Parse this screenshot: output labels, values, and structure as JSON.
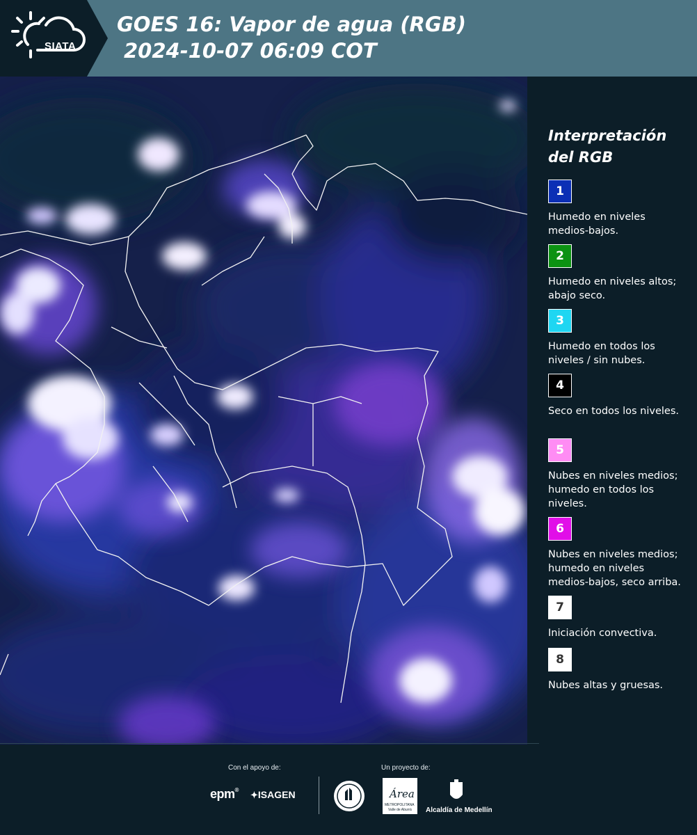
{
  "header": {
    "logo_text": "SIATA",
    "title_line1": "GOES 16: Vapor de agua (RGB)",
    "title_line2": "2024-10-07 06:09 COT",
    "band_color": "#4d7584",
    "dark_color": "#0c1e28"
  },
  "legend": {
    "title_line1": "Interpretación",
    "title_line2": "del RGB",
    "items": [
      {
        "number": "1",
        "color": "#0b2fb5",
        "text_color": "#ffffff",
        "label": "Humedo en niveles medios-bajos."
      },
      {
        "number": "2",
        "color": "#0c9212",
        "text_color": "#ffffff",
        "label": "Humedo en niveles altos; abajo seco."
      },
      {
        "number": "3",
        "color": "#1fd6f2",
        "text_color": "#ffffff",
        "label": "Humedo en todos los niveles / sin nubes."
      },
      {
        "number": "4",
        "color": "#000000",
        "text_color": "#ffffff",
        "label": "Seco en todos los niveles."
      },
      {
        "number": "5",
        "color": "#ff8cf4",
        "text_color": "#ffffff",
        "label": "Nubes en niveles medios; humedo en todos los niveles."
      },
      {
        "number": "6",
        "color": "#e10ee8",
        "text_color": "#ffffff",
        "label": "Nubes en niveles medios; humedo en niveles medios-bajos, seco arriba."
      },
      {
        "number": "7",
        "color": "#ffffff",
        "text_color": "#333333",
        "label": "Iniciación convectiva."
      },
      {
        "number": "8",
        "color": "#ffffff",
        "text_color": "#333333",
        "label": "Nubes altas y gruesas."
      }
    ]
  },
  "footer": {
    "support_label": "Con el apoyo de:",
    "project_label": "Un proyecto de:",
    "sponsor1": "epm",
    "sponsor2": "ISAGEN",
    "sponsor3_line1": "Área",
    "sponsor3_line2": "METROPOLITANA",
    "sponsor3_line3": "Valle de Aburrá",
    "sponsor4": "Alcaldía de Medellín"
  }
}
